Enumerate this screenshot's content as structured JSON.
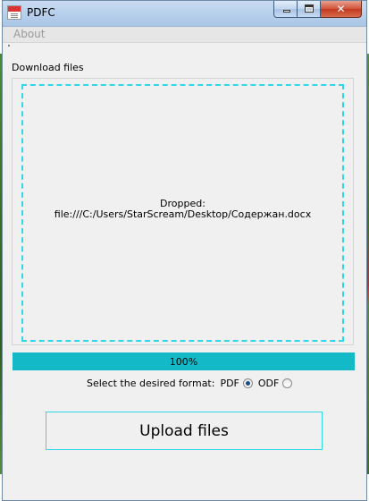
{
  "window": {
    "title": "PDFC",
    "controls": {
      "minimize": "minimize-icon",
      "maximize": "maximize-icon",
      "close": "close-icon"
    }
  },
  "menu": {
    "about": "About"
  },
  "download": {
    "label": "Download files",
    "drop_line1": "Dropped:",
    "drop_line2": "file:///C:/Users/StarScream/Desktop/Содержан.docx"
  },
  "progress": {
    "value": 100,
    "text": "100%"
  },
  "format": {
    "prompt": "Select the desired format:",
    "options": [
      {
        "label": "PDF",
        "selected": true
      },
      {
        "label": "ODF",
        "selected": false
      }
    ]
  },
  "upload_button": "Upload files",
  "colors": {
    "accent": "#2fd7ea",
    "progress": "#14b9c8"
  }
}
